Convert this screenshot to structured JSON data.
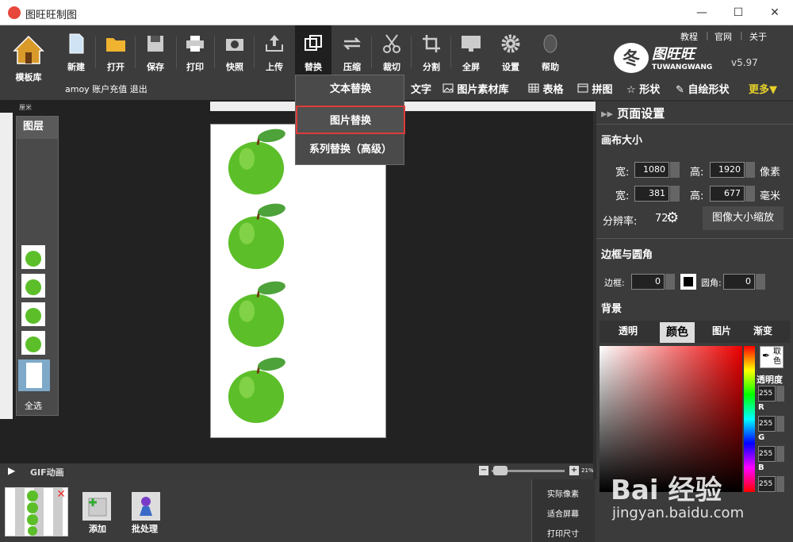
{
  "window": {
    "title": "图旺旺制图",
    "min": "—",
    "max": "☐",
    "close": "✕"
  },
  "toolbar": {
    "home_label": "模板库",
    "buttons": [
      "新建",
      "打开",
      "保存",
      "打印",
      "快照",
      "上传",
      "替换",
      "压缩",
      "裁切",
      "分割",
      "全屏",
      "设置",
      "帮助"
    ],
    "top_links": [
      "教程",
      "官网",
      "关于"
    ],
    "brand": "图旺旺",
    "brand_en": "TUWANGWANG",
    "version": "v5.97",
    "account": "amoy  账户充值  退出",
    "subtools": [
      "文字",
      "图片素材库",
      "表格",
      "拼图",
      "形状",
      "自绘形状"
    ],
    "more": "更多▼"
  },
  "replace_menu": {
    "items": [
      "文本替换",
      "图片替换",
      "系列替换（高级）"
    ],
    "selected": "图片替换"
  },
  "layers": {
    "title": "图层",
    "select_all": "全选"
  },
  "ruler": {
    "unit": "厘米"
  },
  "gif": {
    "label": "GIF动画",
    "zoom": "21%"
  },
  "bottom": {
    "add": "添加",
    "batch": "批处理",
    "views": [
      "实际像素",
      "适合屏幕",
      "打印尺寸"
    ]
  },
  "right": {
    "title": "页面设置",
    "canvas_size": "画布大小",
    "width_label": "宽:",
    "height_label": "高:",
    "width_px": "1080",
    "height_px": "1920",
    "unit_px": "像素",
    "width_mm": "381",
    "height_mm": "677",
    "unit_mm": "毫米",
    "resolution_label": "分辨率:",
    "resolution": "72",
    "resize_button": "图像大小缩放",
    "border_section": "边框与圆角",
    "border_label": "边框:",
    "border_value": "0",
    "radius_label": "圆角:",
    "radius_value": "0",
    "bg_section": "背景",
    "bg_tabs": [
      "透明",
      "颜色",
      "图片",
      "渐变"
    ],
    "pick_color": "取色",
    "opacity": "透明度",
    "opacity_value": "255",
    "r_label": "R",
    "r_value": "255",
    "g_label": "G",
    "g_value": "255",
    "b_label": "B",
    "b_value": "255"
  },
  "watermark": {
    "text": "Bai  经验",
    "url": "jingyan.baidu.com"
  }
}
